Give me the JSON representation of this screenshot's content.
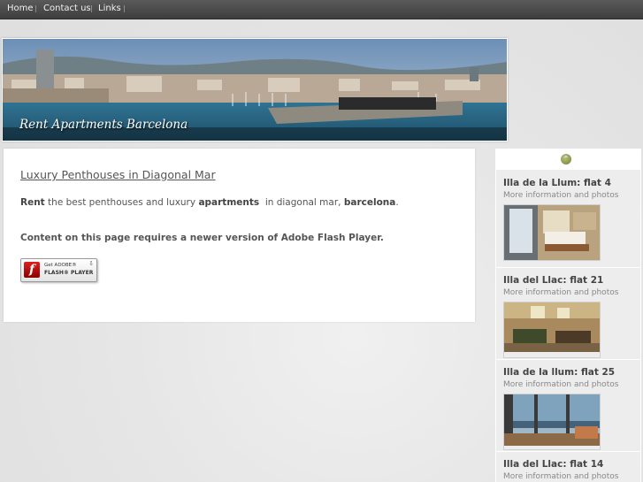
{
  "nav": {
    "items": [
      "Home",
      "Contact us",
      "Links"
    ],
    "separator": "|"
  },
  "banner": {
    "caption": "Rent Apartments Barcelona"
  },
  "content": {
    "title": "Luxury Penthouses in Diagonal Mar",
    "intro": {
      "rent": "Rent",
      "t1": " the best penthouses and luxury ",
      "apartments": "apartments",
      "t2": "  in diagonal mar, ",
      "barcelona": "barcelona",
      "t3": "."
    },
    "flash_message": "Content on this page requires a newer version of Adobe Flash Player.",
    "flash_button": {
      "line1": "Get ADOBE®",
      "line2": "FLASH® PLAYER"
    }
  },
  "sidebar": {
    "up_icon": "chevron-up-icon",
    "entries": [
      {
        "name": "Illa de la Llum: flat 4",
        "more": "More information and photos"
      },
      {
        "name": "Illa del Llac: flat 21",
        "more": "More information and photos"
      },
      {
        "name": "Illa de la llum: flat 25",
        "more": "More information and photos"
      },
      {
        "name": "Illa del Llac: flat 14",
        "more": "More information and photos"
      }
    ]
  },
  "colors": {
    "nav_bg": "#4a4a4a",
    "sea": "#2f6f8f",
    "accent_green": "#7d8c3a"
  }
}
